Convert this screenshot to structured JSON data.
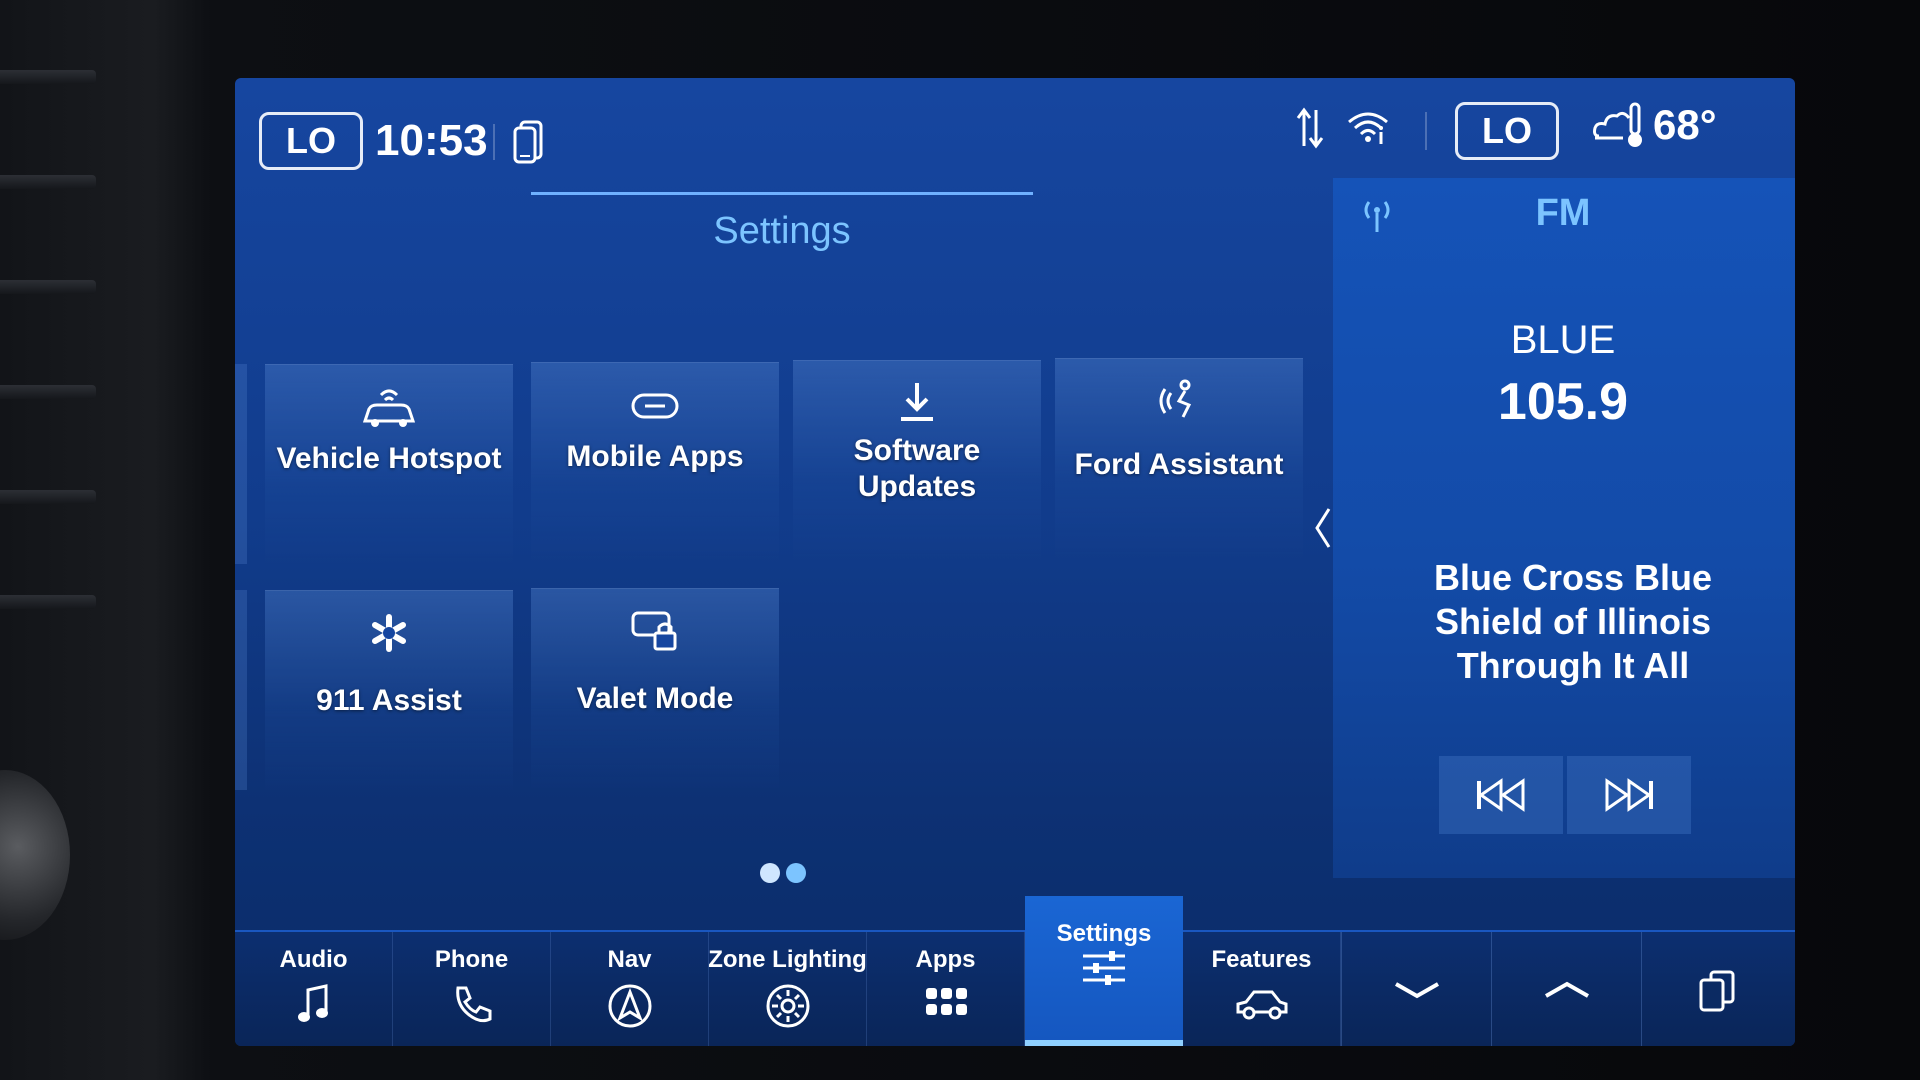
{
  "status_bar": {
    "left_climate": "LO",
    "time": "10:53",
    "right_climate": "LO",
    "outside_temp": "68°"
  },
  "settings": {
    "title": "Settings",
    "tiles": [
      {
        "label": "Vehicle Hotspot",
        "icon": "vehicle-hotspot-icon"
      },
      {
        "label": "Mobile Apps",
        "icon": "mobile-apps-icon"
      },
      {
        "label": "Software\nUpdates",
        "icon": "download-icon"
      },
      {
        "label": "Ford Assistant",
        "icon": "ford-assistant-icon"
      },
      {
        "label": "911 Assist",
        "icon": "emergency-star-icon"
      },
      {
        "label": "Valet Mode",
        "icon": "valet-lock-icon"
      }
    ],
    "page_indicator": {
      "pages": 2,
      "current": 2
    }
  },
  "audio": {
    "band": "FM",
    "station_name": "BLUE",
    "frequency": "105.9",
    "now_playing": "Blue Cross Blue\nShield of Illinois\nThrough It All"
  },
  "nav": {
    "audio": "Audio",
    "phone": "Phone",
    "nav": "Nav",
    "zone_lighting": "Zone Lighting",
    "apps": "Apps",
    "settings": "Settings",
    "features": "Features"
  },
  "colors": {
    "screen_blue": "#1646a0",
    "accent_light_blue": "#7cc4ff",
    "active_tab_blue": "#1a66d4"
  }
}
